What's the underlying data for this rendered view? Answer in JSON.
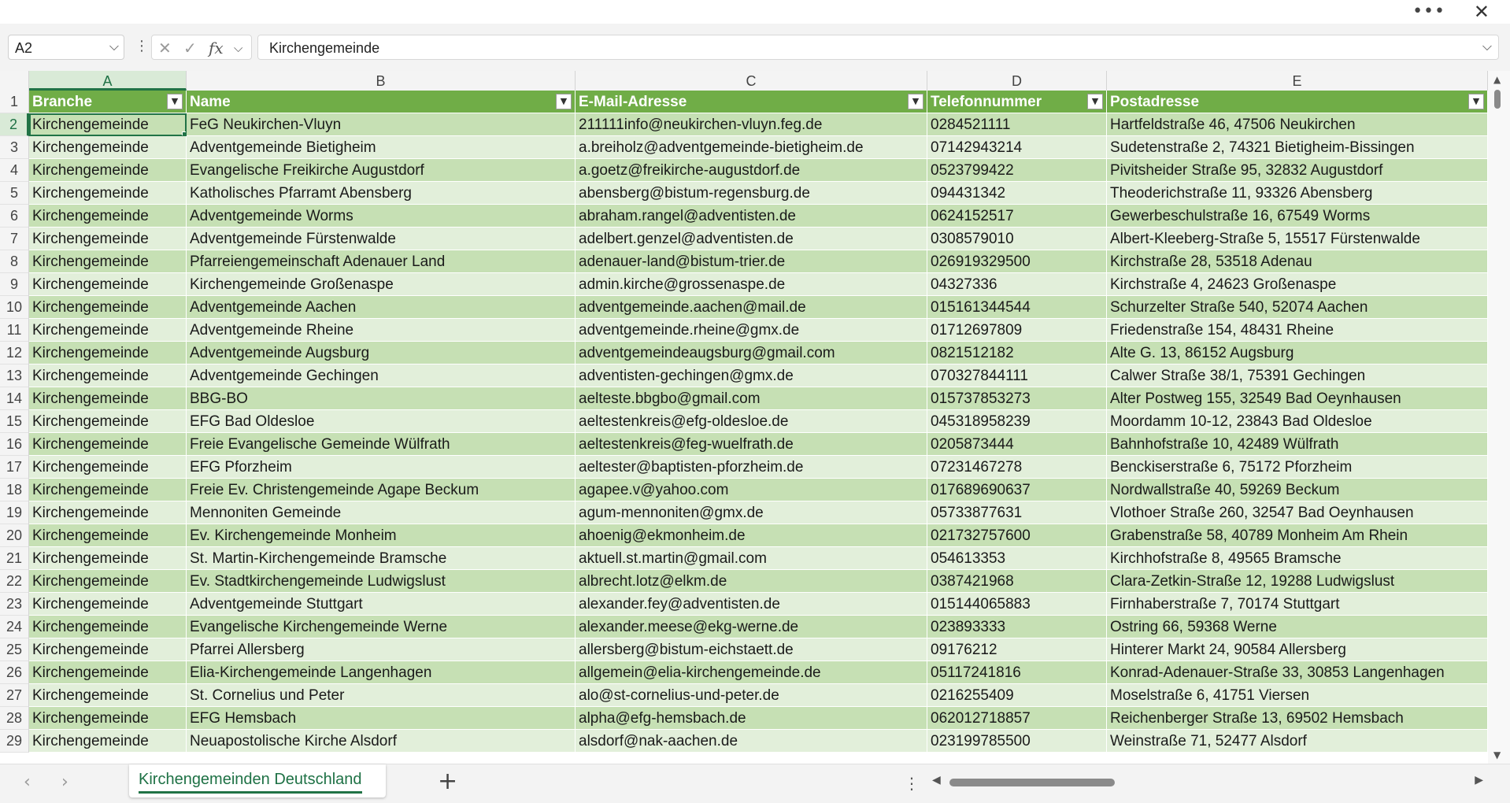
{
  "window": {
    "more_icon": "ellipsis-icon",
    "close_icon": "close-icon"
  },
  "formula_bar": {
    "name_box": "A2",
    "formula": "Kirchengemeinde",
    "fx_label": "fx"
  },
  "columns": [
    "A",
    "B",
    "C",
    "D",
    "E"
  ],
  "selected_column": "A",
  "header_row": {
    "row_num": "1",
    "cells": [
      "Branche",
      "Name",
      "E-Mail-Adresse",
      "Telefonnummer",
      "Postadresse"
    ]
  },
  "rows": [
    {
      "n": "2",
      "cells": [
        "Kirchengemeinde",
        "FeG Neukirchen-Vluyn",
        "211111info@neukirchen-vluyn.feg.de",
        "0284521111",
        "Hartfeldstraße 46, 47506 Neukirchen"
      ]
    },
    {
      "n": "3",
      "cells": [
        "Kirchengemeinde",
        "Adventgemeinde Bietigheim",
        "a.breiholz@adventgemeinde-bietigheim.de",
        "07142943214",
        "Sudetenstraße 2, 74321 Bietigheim-Bissingen"
      ]
    },
    {
      "n": "4",
      "cells": [
        "Kirchengemeinde",
        "Evangelische Freikirche Augustdorf",
        "a.goetz@freikirche-augustdorf.de",
        "0523799422",
        "Pivitsheider Straße 95, 32832 Augustdorf"
      ]
    },
    {
      "n": "5",
      "cells": [
        "Kirchengemeinde",
        "Katholisches Pfarramt Abensberg",
        "abensberg@bistum-regensburg.de",
        "094431342",
        "Theoderichstraße 11, 93326 Abensberg"
      ]
    },
    {
      "n": "6",
      "cells": [
        "Kirchengemeinde",
        "Adventgemeinde Worms",
        "abraham.rangel@adventisten.de",
        "0624152517",
        "Gewerbeschulstraße 16, 67549 Worms"
      ]
    },
    {
      "n": "7",
      "cells": [
        "Kirchengemeinde",
        "Adventgemeinde Fürstenwalde",
        "adelbert.genzel@adventisten.de",
        "0308579010",
        "Albert-Kleeberg-Straße 5, 15517 Fürstenwalde"
      ]
    },
    {
      "n": "8",
      "cells": [
        "Kirchengemeinde",
        "Pfarreiengemeinschaft Adenauer Land",
        "adenauer-land@bistum-trier.de",
        "026919329500",
        "Kirchstraße 28, 53518 Adenau"
      ]
    },
    {
      "n": "9",
      "cells": [
        "Kirchengemeinde",
        "Kirchengemeinde Großenaspe",
        "admin.kirche@grossenaspe.de",
        "04327336",
        "Kirchstraße 4, 24623 Großenaspe"
      ]
    },
    {
      "n": "10",
      "cells": [
        "Kirchengemeinde",
        "Adventgemeinde Aachen",
        "adventgemeinde.aachen@mail.de",
        "015161344544",
        "Schurzelter Straße 540, 52074 Aachen"
      ]
    },
    {
      "n": "11",
      "cells": [
        "Kirchengemeinde",
        "Adventgemeinde Rheine",
        "adventgemeinde.rheine@gmx.de",
        "01712697809",
        "Friedenstraße 154, 48431 Rheine"
      ]
    },
    {
      "n": "12",
      "cells": [
        "Kirchengemeinde",
        "Adventgemeinde Augsburg",
        "adventgemeindeaugsburg@gmail.com",
        "0821512182",
        "Alte G. 13, 86152 Augsburg"
      ]
    },
    {
      "n": "13",
      "cells": [
        "Kirchengemeinde",
        "Adventgemeinde Gechingen",
        "adventisten-gechingen@gmx.de",
        "070327844111",
        "Calwer Straße 38/1, 75391 Gechingen"
      ]
    },
    {
      "n": "14",
      "cells": [
        "Kirchengemeinde",
        "BBG-BO",
        "aelteste.bbgbo@gmail.com",
        "015737853273",
        "Alter Postweg 155, 32549 Bad Oeynhausen"
      ]
    },
    {
      "n": "15",
      "cells": [
        "Kirchengemeinde",
        "EFG Bad Oldesloe",
        "aeltestenkreis@efg-oldesloe.de",
        "045318958239",
        "Moordamm 10-12, 23843 Bad Oldesloe"
      ]
    },
    {
      "n": "16",
      "cells": [
        "Kirchengemeinde",
        "Freie Evangelische Gemeinde Wülfrath",
        "aeltestenkreis@feg-wuelfrath.de",
        "0205873444",
        "Bahnhofstraße 10, 42489 Wülfrath"
      ]
    },
    {
      "n": "17",
      "cells": [
        "Kirchengemeinde",
        "EFG Pforzheim",
        "aeltester@baptisten-pforzheim.de",
        "07231467278",
        "Benckiserstraße 6, 75172 Pforzheim"
      ]
    },
    {
      "n": "18",
      "cells": [
        "Kirchengemeinde",
        "Freie Ev. Christengemeinde Agape Beckum",
        "agapee.v@yahoo.com",
        "017689690637",
        "Nordwallstraße 40, 59269 Beckum"
      ]
    },
    {
      "n": "19",
      "cells": [
        "Kirchengemeinde",
        "Mennoniten Gemeinde",
        "agum-mennoniten@gmx.de",
        "05733877631",
        "Vlothoer Straße 260, 32547 Bad Oeynhausen"
      ]
    },
    {
      "n": "20",
      "cells": [
        "Kirchengemeinde",
        "Ev. Kirchengemeinde Monheim",
        "ahoenig@ekmonheim.de",
        "021732757600",
        "Grabenstraße 58, 40789 Monheim Am Rhein"
      ]
    },
    {
      "n": "21",
      "cells": [
        "Kirchengemeinde",
        "St. Martin-Kirchengemeinde Bramsche",
        "aktuell.st.martin@gmail.com",
        "054613353",
        "Kirchhofstraße 8, 49565 Bramsche"
      ]
    },
    {
      "n": "22",
      "cells": [
        "Kirchengemeinde",
        "Ev. Stadtkirchengemeinde Ludwigslust",
        "albrecht.lotz@elkm.de",
        "0387421968",
        "Clara-Zetkin-Straße 12, 19288 Ludwigslust"
      ]
    },
    {
      "n": "23",
      "cells": [
        "Kirchengemeinde",
        "Adventgemeinde Stuttgart",
        "alexander.fey@adventisten.de",
        "015144065883",
        "Firnhaberstraße 7, 70174 Stuttgart"
      ]
    },
    {
      "n": "24",
      "cells": [
        "Kirchengemeinde",
        "Evangelische Kirchengemeinde Werne",
        "alexander.meese@ekg-werne.de",
        "023893333",
        "Ostring 66, 59368 Werne"
      ]
    },
    {
      "n": "25",
      "cells": [
        "Kirchengemeinde",
        "Pfarrei Allersberg",
        "allersberg@bistum-eichstaett.de",
        "09176212",
        "Hinterer Markt 24, 90584 Allersberg"
      ]
    },
    {
      "n": "26",
      "cells": [
        "Kirchengemeinde",
        "Elia-Kirchengemeinde Langenhagen",
        "allgemein@elia-kirchengemeinde.de",
        "05117241816",
        "Konrad-Adenauer-Straße 33, 30853 Langenhagen"
      ]
    },
    {
      "n": "27",
      "cells": [
        "Kirchengemeinde",
        "St. Cornelius und Peter",
        "alo@st-cornelius-und-peter.de",
        "0216255409",
        "Moselstraße 6, 41751 Viersen"
      ]
    },
    {
      "n": "28",
      "cells": [
        "Kirchengemeinde",
        "EFG Hemsbach",
        "alpha@efg-hemsbach.de",
        "062012718857",
        "Reichenberger Straße 13, 69502 Hemsbach"
      ]
    },
    {
      "n": "29",
      "cells": [
        "Kirchengemeinde",
        "Neuapostolische Kirche Alsdorf",
        "alsdorf@nak-aachen.de",
        "023199785500",
        "Weinstraße 71, 52477 Alsdorf"
      ]
    }
  ],
  "sheet_tab": {
    "label": "Kirchengemeinden Deutschland"
  },
  "colors": {
    "header_green": "#70ad47",
    "band_dark": "#c6e0b4",
    "band_light": "#e2efda",
    "accent": "#217346"
  }
}
